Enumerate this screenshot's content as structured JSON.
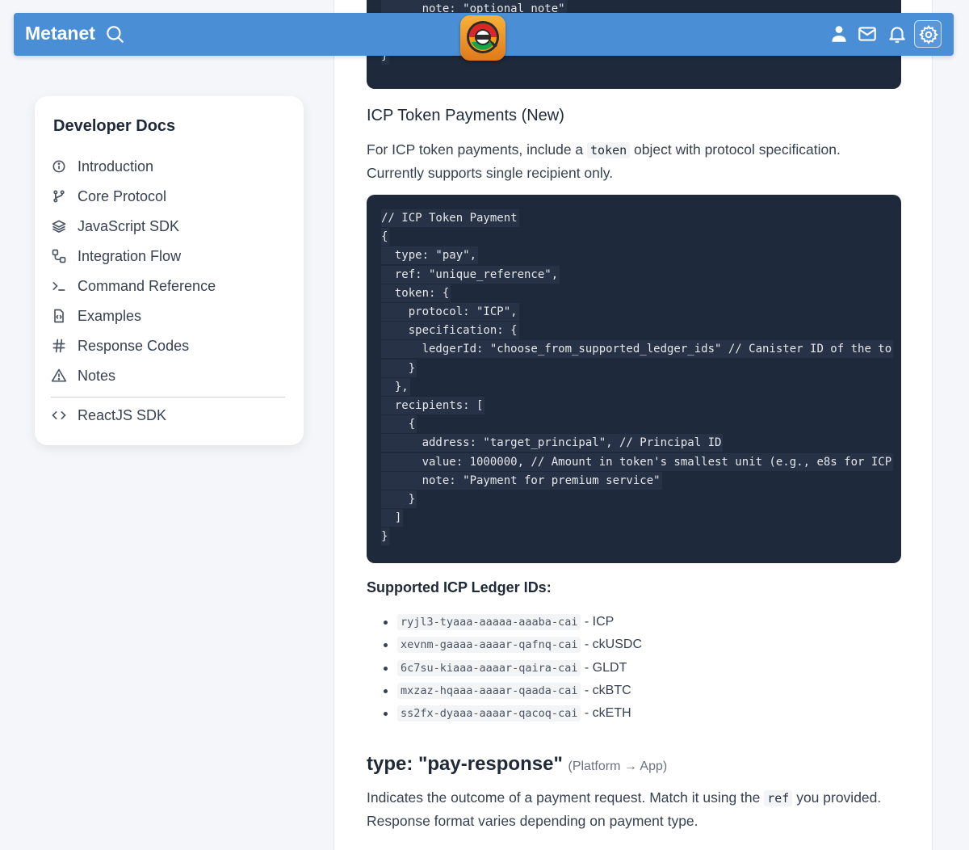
{
  "header": {
    "brand": "Metanet",
    "icons": [
      "search-icon",
      "user-icon",
      "mail-icon",
      "bell-icon",
      "gear-icon"
    ],
    "accent": "#4a8fd6"
  },
  "sidebar": {
    "title": "Developer Docs",
    "items": [
      {
        "label": "Introduction",
        "icon": "info-icon"
      },
      {
        "label": "Core Protocol",
        "icon": "git-branch-icon"
      },
      {
        "label": "JavaScript SDK",
        "icon": "layers-icon"
      },
      {
        "label": "Integration Flow",
        "icon": "workflow-icon"
      },
      {
        "label": "Command Reference",
        "icon": "terminal-icon"
      },
      {
        "label": "Examples",
        "icon": "file-code-icon"
      },
      {
        "label": "Response Codes",
        "icon": "hash-icon"
      },
      {
        "label": "Notes",
        "icon": "warning-icon"
      }
    ],
    "extra": {
      "label": "ReactJS SDK",
      "icon": "code-icon"
    }
  },
  "content": {
    "top_code_lines": [
      "      note: \"optional note\"",
      "}"
    ],
    "icp_heading": "ICP Token Payments (New)",
    "icp_para_1": "For ICP token payments, include a ",
    "icp_para_code": "token",
    "icp_para_2": " object with protocol specification. Currently supports single recipient only.",
    "code_lines": [
      "// ICP Token Payment",
      "{",
      "  type: \"pay\",",
      "  ref: \"unique_reference\",",
      "  token: {",
      "    protocol: \"ICP\",",
      "    specification: {",
      "      ledgerId: \"choose_from_supported_ledger_ids\" // Canister ID of the to",
      "    }",
      "  },",
      "  recipients: [",
      "    {",
      "      address: \"target_principal\", // Principal ID",
      "      value: 1000000, // Amount in token's smallest unit (e.g., e8s for ICP",
      "      note: \"Payment for premium service\"",
      "    }",
      "  ]",
      "}"
    ],
    "ledger_heading": "Supported ICP Ledger IDs:",
    "ledgers": [
      {
        "id": "ryjl3-tyaaa-aaaaa-aaaba-cai",
        "name": "- ICP"
      },
      {
        "id": "xevnm-gaaaa-aaaar-qafnq-cai",
        "name": "- ckUSDC"
      },
      {
        "id": "6c7su-kiaaa-aaaar-qaira-cai",
        "name": "- GLDT"
      },
      {
        "id": "mxzaz-hqaaa-aaaar-qaada-cai",
        "name": "- ckBTC"
      },
      {
        "id": "ss2fx-dyaaa-aaaar-qacoq-cai",
        "name": "- ckETH"
      }
    ],
    "response_heading": "type: \"pay-response\"",
    "response_sub": "(Platform → App)",
    "response_para_1": "Indicates the outcome of a payment request. Match it using the ",
    "response_para_code": "ref",
    "response_para_2": " you provided. Response format varies depending on payment type."
  }
}
